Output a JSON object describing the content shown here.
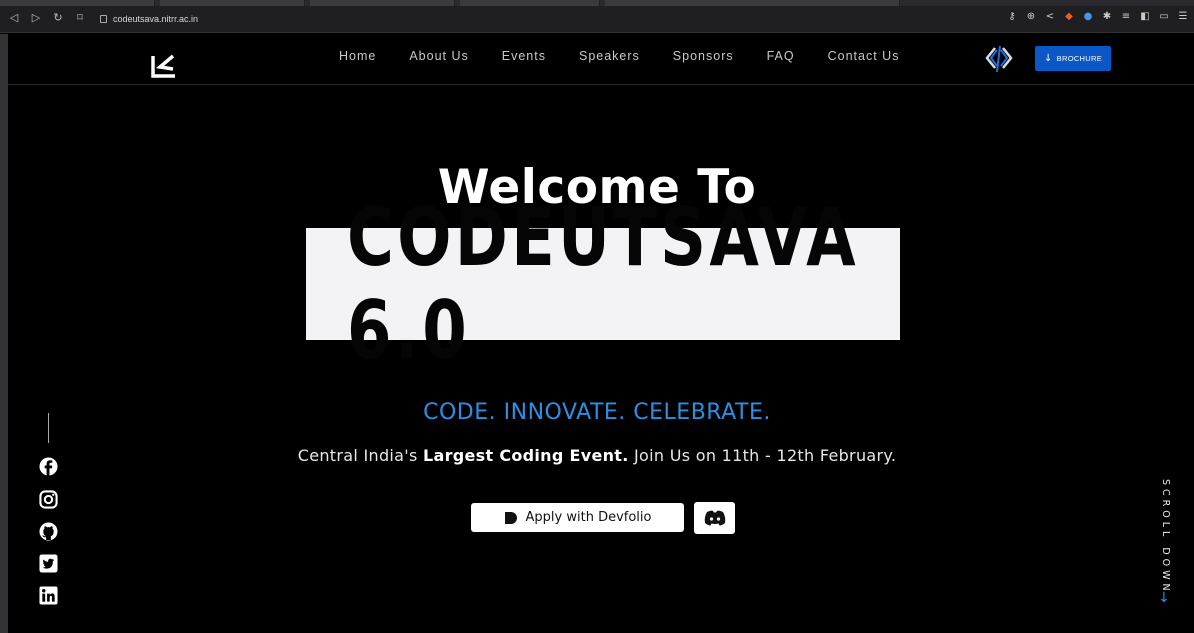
{
  "browser": {
    "url": "codeutsava.nitrr.ac.in"
  },
  "nav": {
    "items": [
      "Home",
      "About Us",
      "Events",
      "Speakers",
      "Sponsors",
      "FAQ",
      "Contact Us"
    ],
    "brochure_label": "BROCHURE"
  },
  "hero": {
    "welcome": "Welcome To",
    "title": "CODEUTSAVA 6.0",
    "tagline": "CODE. INNOVATE. CELEBRATE.",
    "subline_prefix": "Central India's ",
    "subline_bold": "Largest Coding Event.",
    "subline_suffix": " Join Us on 11th - 12th February."
  },
  "buttons": {
    "devfolio": "Apply with Devfolio"
  },
  "scroll": {
    "label": "SCROLL DOWN",
    "arrow": "↓"
  },
  "socials": [
    "facebook-icon",
    "instagram-icon",
    "github-icon",
    "twitter-icon",
    "linkedin-icon"
  ],
  "colors": {
    "accent_blue": "#2d8fe3",
    "brochure_blue": "#0b57c6",
    "background": "#000000"
  }
}
